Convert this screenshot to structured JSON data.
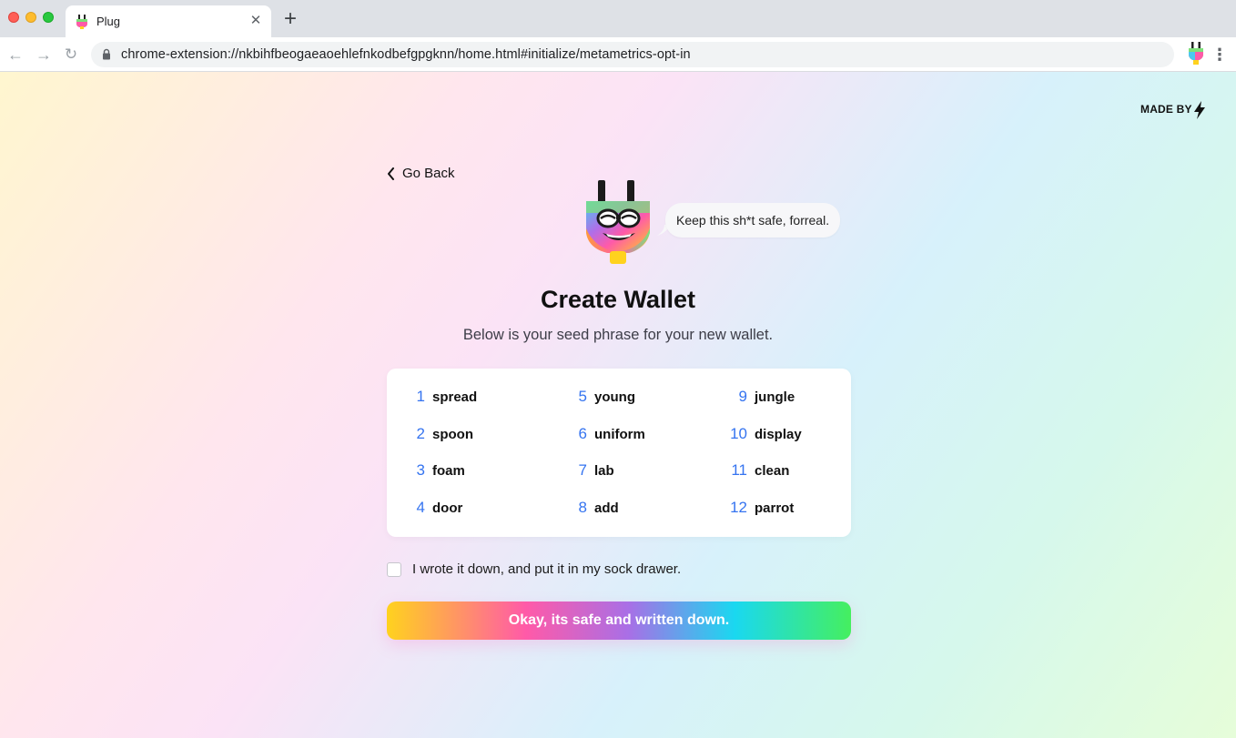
{
  "browser": {
    "tab_title": "Plug",
    "url": "chrome-extension://nkbihfbeogaeaoehlefnkodbefgpgknn/home.html#initialize/metametrics-opt-in"
  },
  "header": {
    "made_by_label": "MADE BY"
  },
  "nav": {
    "go_back_label": "Go Back"
  },
  "mascot": {
    "speech": "Keep this sh*t safe, forreal."
  },
  "main": {
    "title": "Create Wallet",
    "subtitle": "Below is your seed phrase for your new wallet."
  },
  "seed_phrase": [
    {
      "number": "1",
      "word": "spread"
    },
    {
      "number": "2",
      "word": "spoon"
    },
    {
      "number": "3",
      "word": "foam"
    },
    {
      "number": "4",
      "word": "door"
    },
    {
      "number": "5",
      "word": "young"
    },
    {
      "number": "6",
      "word": "uniform"
    },
    {
      "number": "7",
      "word": "lab"
    },
    {
      "number": "8",
      "word": "add"
    },
    {
      "number": "9",
      "word": "jungle"
    },
    {
      "number": "10",
      "word": "display"
    },
    {
      "number": "11",
      "word": "clean"
    },
    {
      "number": "12",
      "word": "parrot"
    }
  ],
  "confirm": {
    "label": "I wrote it down, and put it in my sock drawer.",
    "checked": false
  },
  "cta": {
    "label": "Okay, its safe and written down."
  },
  "colors": {
    "accent_number": "#3574f0",
    "button_gradient": [
      "#ffd21e",
      "#ff5aa8",
      "#a96fe6",
      "#1ad8f0",
      "#45ef5f"
    ]
  },
  "icons": [
    "close-icon",
    "plus-icon",
    "back-arrow-icon",
    "forward-arrow-icon",
    "reload-icon",
    "lock-icon",
    "plug-extension-icon",
    "more-vert-icon",
    "bolt-icon",
    "chevron-left-icon",
    "plug-mascot-icon"
  ]
}
